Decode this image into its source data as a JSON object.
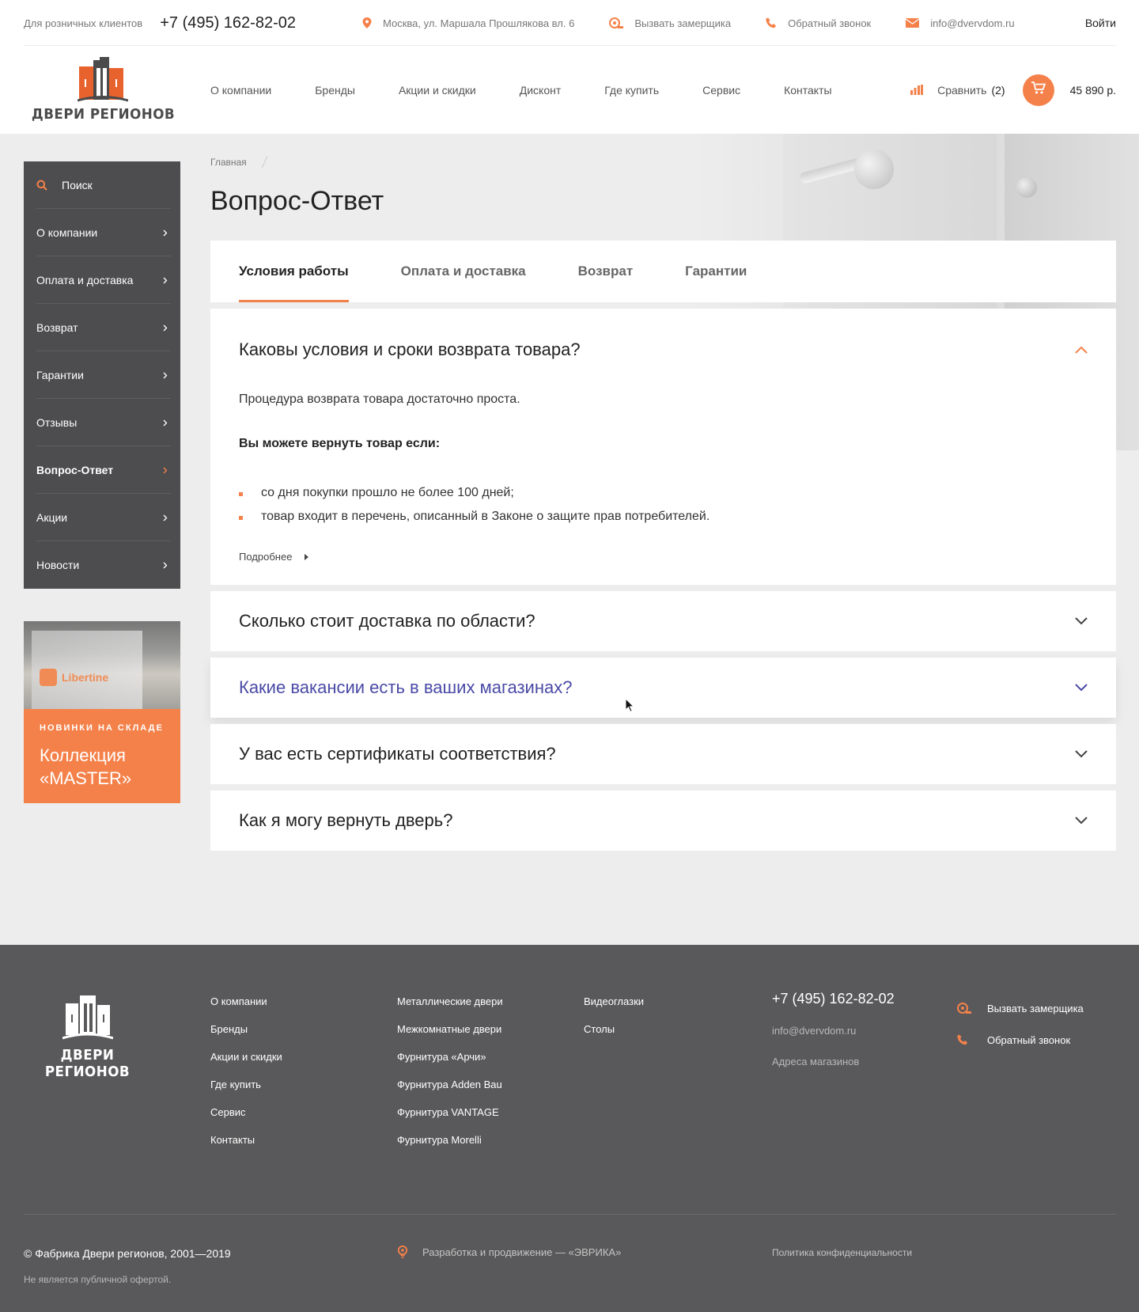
{
  "topbar": {
    "retail_label": "Для розничных клиентов",
    "phone": "+7 (495) 162-82-02",
    "address": "Москва, ул. Маршала Прошлякова вл. 6",
    "measure_label": "Вызвать замерщика",
    "callback_label": "Обратный звонок",
    "email": "info@dvervdom.ru",
    "login_label": "Войти"
  },
  "header": {
    "logo_text": "ДВЕРИ РЕГИОНОВ",
    "nav": [
      "О компании",
      "Бренды",
      "Акции и скидки",
      "Дисконт",
      "Где купить",
      "Сервис",
      "Контакты"
    ],
    "compare_label": "Сравнить",
    "compare_count": "(2)",
    "cart_sum": "45 890 р."
  },
  "sidebar": {
    "search_label": "Поиск",
    "items": [
      {
        "label": "О компании"
      },
      {
        "label": "Оплата и доставка"
      },
      {
        "label": "Возврат"
      },
      {
        "label": "Гарантии"
      },
      {
        "label": "Отзывы"
      },
      {
        "label": "Вопрос-Ответ",
        "active": true
      },
      {
        "label": "Акции"
      },
      {
        "label": "Новости"
      }
    ]
  },
  "promo": {
    "brand": "Libertine",
    "kicker": "НОВИНКИ НА СКЛАДЕ",
    "title_line1": "Коллекция",
    "title_line2": "«MASTER»"
  },
  "breadcrumb": {
    "home": "Главная"
  },
  "page_title": "Вопрос-Ответ",
  "tabs": [
    {
      "label": "Условия работы",
      "active": true
    },
    {
      "label": "Оплата и доставка"
    },
    {
      "label": "Возврат"
    },
    {
      "label": "Гарантии"
    }
  ],
  "faq": {
    "open": {
      "question": "Каковы условия и сроки возврата товара?",
      "intro": "Процедура возврата товара достаточно проста.",
      "lead": "Вы можете вернуть товар если:",
      "bullets": [
        "со дня покупки прошло не более 100 дней;",
        "товар входит в перечень, описанный в Законе о защите прав потребителей."
      ],
      "more_label": "Подробнее"
    },
    "collapsed": [
      {
        "question": "Сколько стоит доставка по области?"
      },
      {
        "question": "Какие вакансии есть в ваших магазинах?",
        "hover": true
      },
      {
        "question": "У вас есть сертификаты соответствия?"
      },
      {
        "question": "Как я могу вернуть дверь?"
      }
    ]
  },
  "footer": {
    "logo_text": "ДВЕРИ РЕГИОНОВ",
    "col1": [
      "О компании",
      "Бренды",
      "Акции и скидки",
      "Где купить",
      "Сервис",
      "Контакты"
    ],
    "col2": [
      "Металлические двери",
      "Межкомнатные двери",
      "Фурнитура «Арчи»",
      "Фурнитура Adden Bau",
      "Фурнитура VANTAGE",
      "Фурнитура Morelli"
    ],
    "col3": [
      "Видеоглазки",
      "Столы"
    ],
    "phone": "+7 (495) 162-82-02",
    "email": "info@dvervdom.ru",
    "stores_label": "Адреса магазинов",
    "measure_label": "Вызвать замерщика",
    "callback_label": "Обратный звонок",
    "copyright": "© Фабрика Двери регионов, 2001—2019",
    "not_offer": "Не является публичной офертой.",
    "developer": "Разработка и продвижение — «ЭВРИКА»",
    "policy": "Политика конфиденциальности"
  },
  "colors": {
    "accent": "#f5814a",
    "sidebar_bg": "#4d4d4f",
    "footer_bg": "#59595b",
    "hover_text": "#4a4aa6"
  }
}
